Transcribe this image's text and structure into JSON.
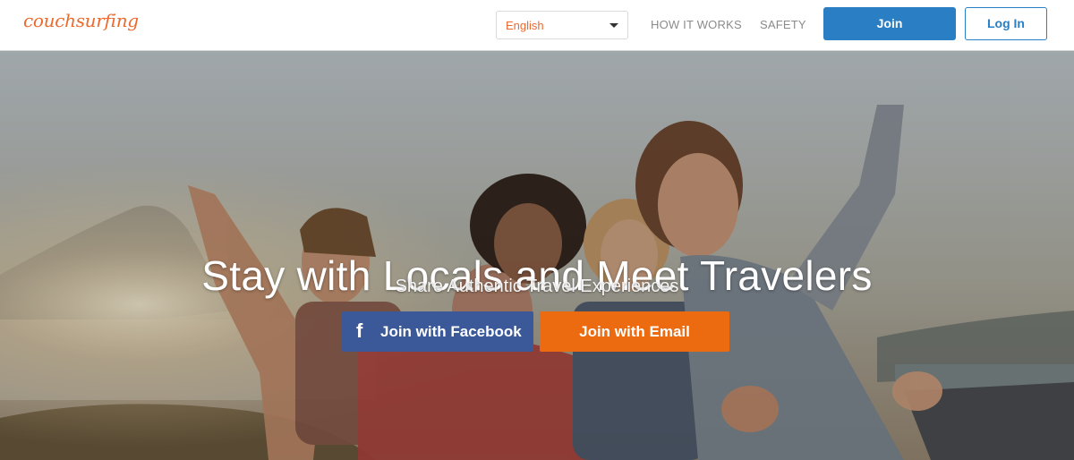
{
  "header": {
    "logo_text": "couchsurfing",
    "language": {
      "selected": "English"
    },
    "nav": {
      "how_it_works": "HOW IT WORKS",
      "safety": "SAFETY"
    },
    "join_label": "Join",
    "login_label": "Log In"
  },
  "hero": {
    "headline": "Stay with Locals and Meet Travelers",
    "subheadline": "Share Authentic Travel Experiences",
    "facebook_button": {
      "icon": "facebook-icon",
      "glyph": "f",
      "label": "Join with Facebook"
    },
    "email_button": {
      "label": "Join with Email"
    }
  },
  "colors": {
    "brand_orange": "#ed6a2e",
    "join_blue": "#2a7fc4",
    "facebook_blue": "#3b5998",
    "email_orange": "#ec6a10"
  }
}
